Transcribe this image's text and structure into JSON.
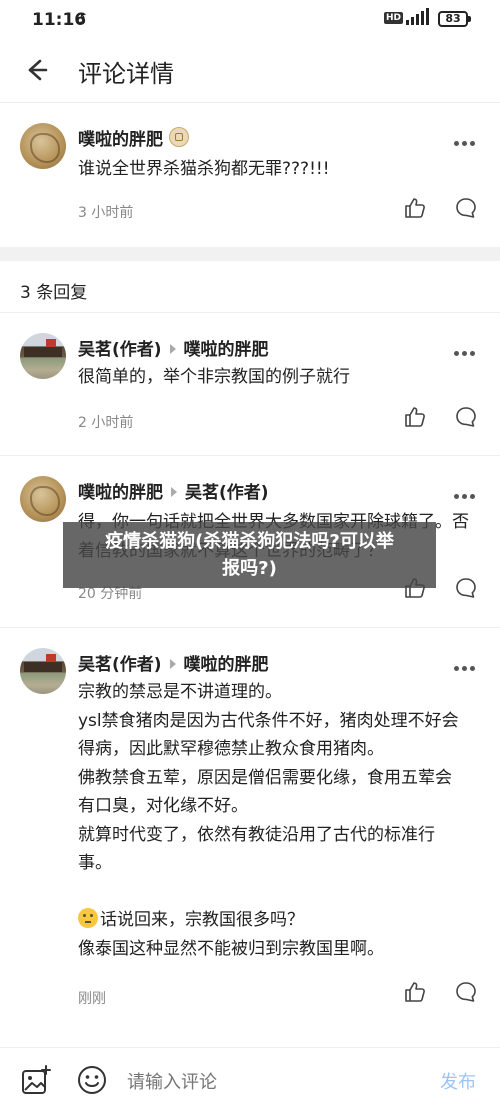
{
  "status": {
    "time": "11:16",
    "icon_sync": "↺",
    "hd": "HD",
    "battery": "83"
  },
  "header": {
    "title": "评论详情"
  },
  "main_comment": {
    "user": "噗啦的胖肥",
    "text": "谁说全世界杀猫杀狗都无罪???!!!",
    "time": "3 小时前"
  },
  "replies_label": "3 条回复",
  "replies": [
    {
      "user": "吴茗(作者)",
      "reply_to": "噗啦的胖肥",
      "text": "很简单的，举个非宗教国的例子就行",
      "time": "2 小时前"
    },
    {
      "user": "噗啦的胖肥",
      "reply_to": "吴茗(作者)",
      "text": "得，你一句话就把全世界大多数国家开除球籍了。否着信教的国家就不算这个世界的范畴了？",
      "time": "20 分钟前"
    },
    {
      "user": "吴茗(作者)",
      "reply_to": "噗啦的胖肥",
      "lines": [
        "宗教的禁忌是不讲道理的。",
        "ysl禁食猪肉是因为古代条件不好，猪肉处理不好会",
        "得病，因此默罕穆德禁止教众食用猪肉。",
        "佛教禁食五荤，原因是僧侣需要化缘，食用五荤会",
        "有口臭，对化缘不好。",
        "就算时代变了，依然有教徒沿用了古代的标准行",
        "事。",
        "",
        "话说回来，宗教国很多吗？",
        "像泰国这种显然不能被归到宗教国里啊。"
      ],
      "time": "刚刚"
    }
  ],
  "overlay": {
    "line1": "疫情杀猫狗(杀猫杀狗犯法吗?可以举",
    "line2": "报吗?)"
  },
  "bottom": {
    "placeholder": "请输入评论",
    "publish": "发布"
  },
  "colors": {
    "publish": "#9ec4f5",
    "meta": "#888888",
    "gap": "#f1f1f1"
  },
  "icons": [
    "back-arrow-icon",
    "more-icon",
    "like-icon",
    "reply-icon",
    "image-icon",
    "emoji-icon",
    "thinking-emoji-icon"
  ]
}
